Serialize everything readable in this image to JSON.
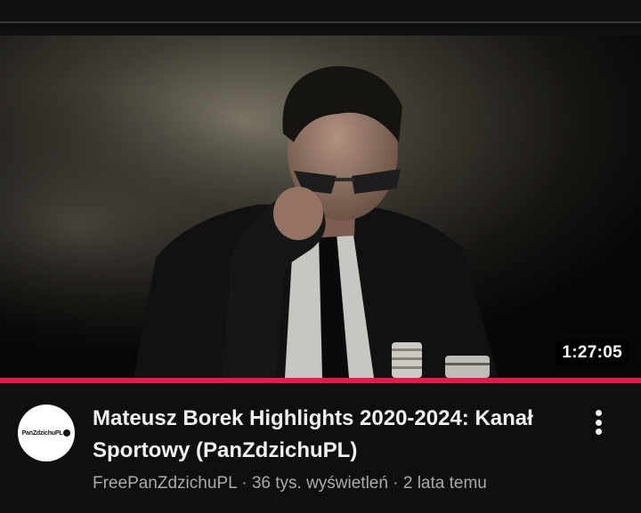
{
  "video": {
    "duration": "1:27:05",
    "progress": 1.0,
    "accent_color": "#e8174c",
    "title": "Mateusz Borek Highlights 2020-2024: Kanał Sportowy (PanZdzichuPL)",
    "channel": "FreePanZdzichuPL",
    "separator": "·",
    "views": "36 tys. wyświetleń",
    "age": "2 lata temu"
  },
  "avatar": {
    "logo_text": "PanZdzichuPL"
  },
  "icons": {
    "menu": "more-vert-icon"
  }
}
